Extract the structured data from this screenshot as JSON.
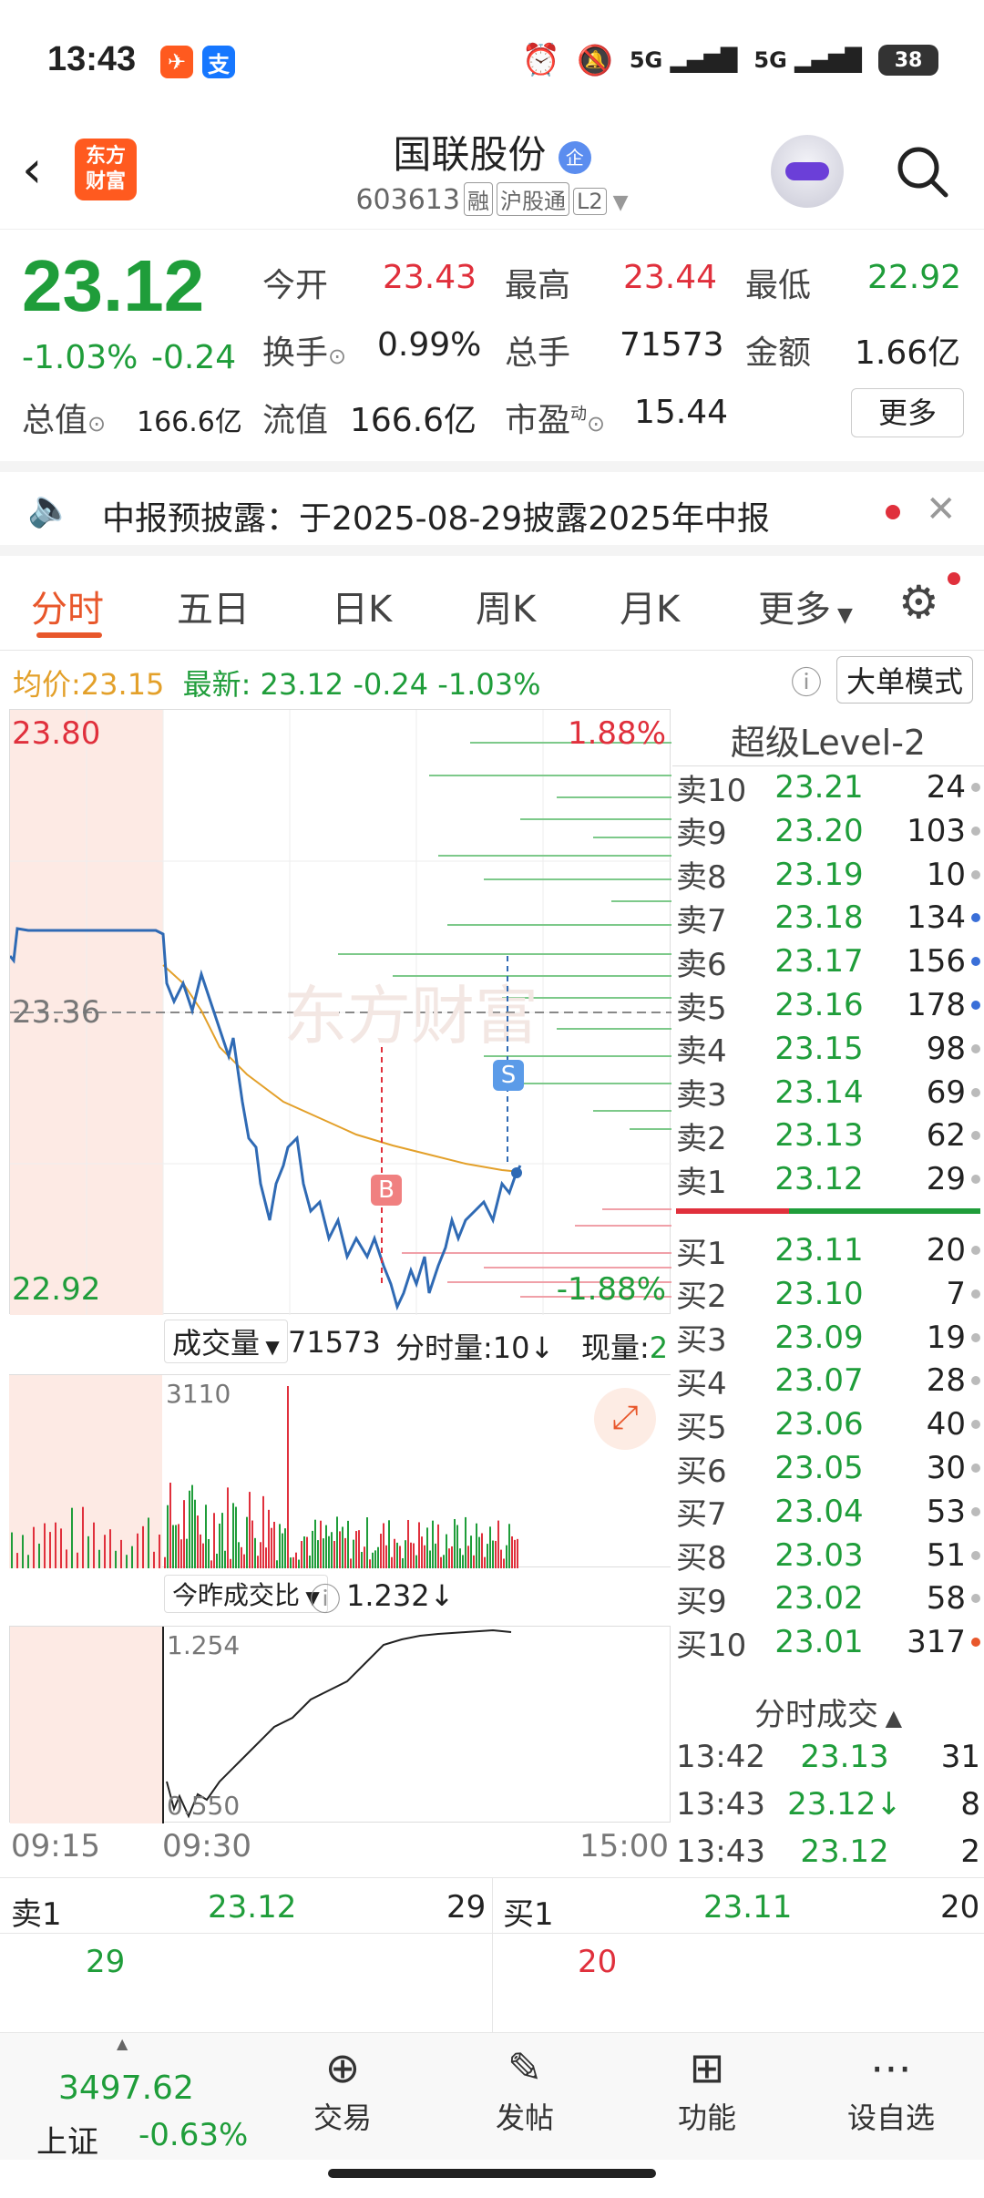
{
  "status_bar": {
    "time": "13:43",
    "battery": "38",
    "signal1": "5G",
    "signal2": "5G"
  },
  "header": {
    "logo_line1": "东方",
    "logo_line2": "财富",
    "stock_name": "国联股份",
    "stock_code": "603613",
    "tags": [
      "融",
      "沪股通",
      "L2"
    ]
  },
  "quote": {
    "price": "23.12",
    "change_pct": "-1.03%",
    "change": "-0.24",
    "open_label": "今开",
    "open": "23.43",
    "high_label": "最高",
    "high": "23.44",
    "low_label": "最低",
    "low": "22.92",
    "turnover_label": "换手",
    "turnover": "0.99%",
    "volume_label": "总手",
    "volume": "71573",
    "amount_label": "金额",
    "amount": "1.66亿",
    "mktcap_label": "总值",
    "mktcap": "166.6亿",
    "float_label": "流值",
    "float": "166.6亿",
    "pe_label": "市盈",
    "pe_sup": "动",
    "pe": "15.44",
    "more_button": "更多"
  },
  "notice": {
    "text": "中报预披露：于2025-08-29披露2025年中报"
  },
  "tabs": [
    "分时",
    "五日",
    "日K",
    "周K",
    "月K",
    "更多"
  ],
  "info_line": {
    "avg_label": "均价:",
    "avg": "23.15",
    "latest_label": "最新:",
    "latest": "23.12",
    "chg": "-0.24",
    "pct": "-1.03%",
    "big_mode": "大单模式"
  },
  "chart": {
    "top_price": "23.80",
    "top_pct": "1.88%",
    "mid_price": "23.36",
    "bottom_price": "22.92",
    "bottom_pct": "-1.88%",
    "marker_b": "B",
    "marker_s": "S",
    "watermark": "东方财富"
  },
  "volume_bar": {
    "label": "成交量",
    "value": "71573",
    "tick_label": "分时量:10↓",
    "now_label": "现量:2",
    "max": "3110"
  },
  "ratio_bar": {
    "label": "今昨成交比",
    "value": "1.232↓",
    "max": "1.254",
    "min": "0.550"
  },
  "time_axis": {
    "start": "09:15",
    "open": "09:30",
    "end": "15:00"
  },
  "level2": {
    "title": "超级Level-2",
    "asks": [
      {
        "label": "卖10",
        "price": "23.21",
        "qty": "24",
        "dot": "grey"
      },
      {
        "label": "卖9",
        "price": "23.20",
        "qty": "103",
        "dot": "grey"
      },
      {
        "label": "卖8",
        "price": "23.19",
        "qty": "10",
        "dot": "grey"
      },
      {
        "label": "卖7",
        "price": "23.18",
        "qty": "134",
        "dot": "blue"
      },
      {
        "label": "卖6",
        "price": "23.17",
        "qty": "156",
        "dot": "blue"
      },
      {
        "label": "卖5",
        "price": "23.16",
        "qty": "178",
        "dot": "blue"
      },
      {
        "label": "卖4",
        "price": "23.15",
        "qty": "98",
        "dot": "grey"
      },
      {
        "label": "卖3",
        "price": "23.14",
        "qty": "69",
        "dot": "grey"
      },
      {
        "label": "卖2",
        "price": "23.13",
        "qty": "62",
        "dot": "grey"
      },
      {
        "label": "卖1",
        "price": "23.12",
        "qty": "29",
        "dot": "grey"
      }
    ],
    "bids": [
      {
        "label": "买1",
        "price": "23.11",
        "qty": "20",
        "dot": "grey"
      },
      {
        "label": "买2",
        "price": "23.10",
        "qty": "7",
        "dot": "grey"
      },
      {
        "label": "买3",
        "price": "23.09",
        "qty": "19",
        "dot": "grey"
      },
      {
        "label": "买4",
        "price": "23.07",
        "qty": "28",
        "dot": "grey"
      },
      {
        "label": "买5",
        "price": "23.06",
        "qty": "40",
        "dot": "grey"
      },
      {
        "label": "买6",
        "price": "23.05",
        "qty": "30",
        "dot": "grey"
      },
      {
        "label": "买7",
        "price": "23.04",
        "qty": "53",
        "dot": "grey"
      },
      {
        "label": "买8",
        "price": "23.03",
        "qty": "51",
        "dot": "grey"
      },
      {
        "label": "买9",
        "price": "23.02",
        "qty": "58",
        "dot": "grey"
      },
      {
        "label": "买10",
        "price": "23.01",
        "qty": "317",
        "dot": "orange"
      }
    ],
    "trades_title": "分时成交",
    "trades": [
      {
        "time": "13:42",
        "price": "23.13",
        "qty": "31",
        "color": "green"
      },
      {
        "time": "13:43",
        "price": "23.12↓",
        "qty": "8",
        "color": "green"
      },
      {
        "time": "13:43",
        "price": "23.12",
        "qty": "2",
        "color": "green"
      }
    ]
  },
  "bottom_quote": {
    "sell_label": "卖1",
    "sell_price": "23.12",
    "sell_qty": "29",
    "sell_sub": "29",
    "buy_label": "买1",
    "buy_price": "23.11",
    "buy_qty": "20",
    "buy_sub": "20"
  },
  "nav": {
    "index_value": "3497.62",
    "index_name": "上证",
    "index_pct": "-0.63%",
    "items": [
      "交易",
      "发帖",
      "功能",
      "设自选"
    ]
  }
}
